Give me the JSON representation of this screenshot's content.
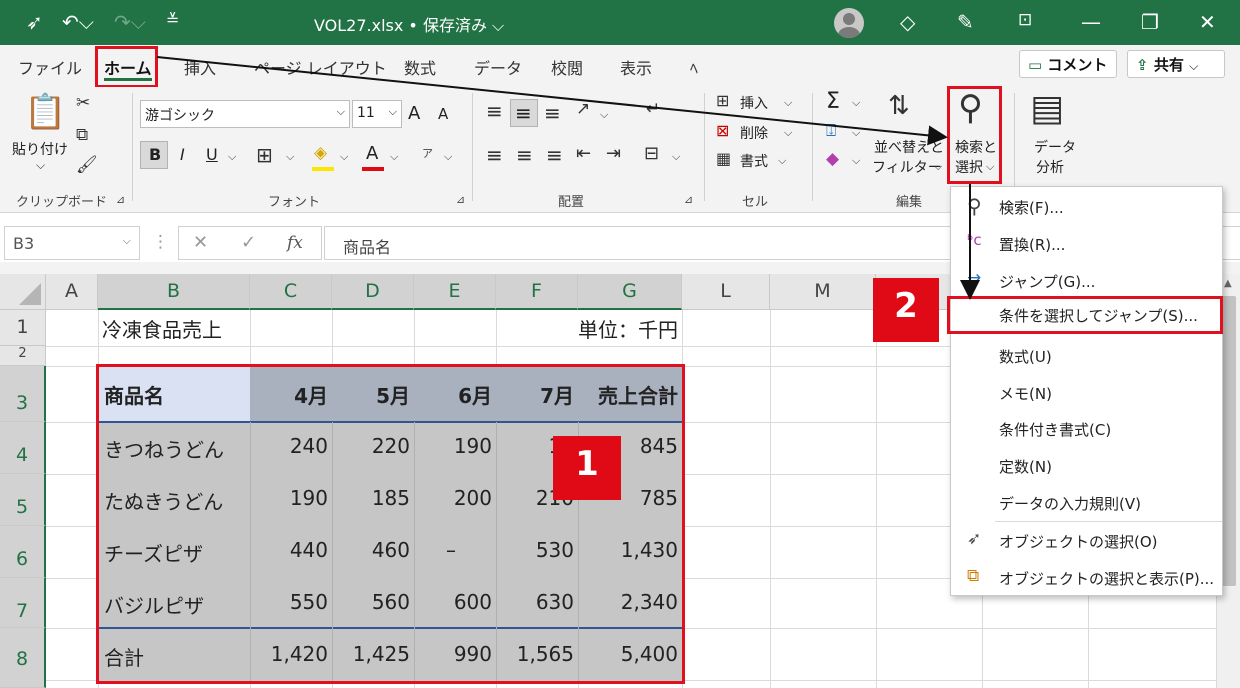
{
  "titlebar": {
    "filename": "VOL27.xlsx • 保存済み ⌵",
    "icons": [
      "select-pointer-icon",
      "undo-icon",
      "redo-icon",
      "customize-icon",
      "diamond-icon",
      "pen-icon",
      "ribbon-display-icon",
      "minimize-icon",
      "restore-icon",
      "close-icon"
    ]
  },
  "tabs": [
    "ファイル",
    "ホーム",
    "挿入",
    "ページ レイアウト",
    "数式",
    "データ",
    "校閲",
    "表示",
    "ﾍ"
  ],
  "comment_label": "コメント",
  "share_label": "共有",
  "ribbon": {
    "clipboard": {
      "paste": "貼り付け",
      "label": "クリップボード"
    },
    "font": {
      "name": "游ゴシック",
      "size": "11",
      "label": "フォント",
      "bold": "B",
      "italic": "I",
      "underline": "U",
      "grow": "A",
      "shrink": "A",
      "font_color": "A",
      "phonetic": "ア"
    },
    "alignment": {
      "label": "配置"
    },
    "cells": {
      "insert": "挿入",
      "delete": "削除",
      "format": "書式",
      "label": "セル"
    },
    "editing": {
      "sum": "Σ",
      "sort_line1": "並べ替えと",
      "sort_line2": "フィルター",
      "find_line1": "検索と",
      "find_line2": "選択",
      "label": "編集"
    },
    "analysis": {
      "line1": "データ",
      "line2": "分析"
    }
  },
  "formula_bar": {
    "namebox": "B3",
    "fx": "fx",
    "value": "商品名"
  },
  "columns": [
    "A",
    "B",
    "C",
    "D",
    "E",
    "F",
    "G",
    "L",
    "M"
  ],
  "rows": [
    "1",
    "2",
    "3",
    "4",
    "5",
    "6",
    "7",
    "8"
  ],
  "sheet": {
    "title": "冷凍食品売上",
    "unit": "単位：千円",
    "header": [
      "商品名",
      "4月",
      "5月",
      "6月",
      "7月",
      "売上合計"
    ],
    "data": [
      [
        "きつねうどん",
        "240",
        "220",
        "190",
        "19",
        "845"
      ],
      [
        "たぬきうどん",
        "190",
        "185",
        "200",
        "210",
        "785"
      ],
      [
        "チーズピザ",
        "440",
        "460",
        "–",
        "530",
        "1,430"
      ],
      [
        "バジルピザ",
        "550",
        "560",
        "600",
        "630",
        "2,340"
      ],
      [
        "合計",
        "1,420",
        "1,425",
        "990",
        "1,565",
        "5,400"
      ]
    ]
  },
  "menu": [
    {
      "label": "検索(F)...",
      "icon": "search-icon"
    },
    {
      "label": "置換(R)...",
      "icon": "replace-icon"
    },
    {
      "label": "ジャンプ(G)...",
      "icon": "arrow-right-icon"
    },
    {
      "label": "条件を選択してジャンプ(S)...",
      "icon": ""
    },
    {
      "label": "数式(U)",
      "icon": ""
    },
    {
      "label": "メモ(N)",
      "icon": ""
    },
    {
      "label": "条件付き書式(C)",
      "icon": ""
    },
    {
      "label": "定数(N)",
      "icon": ""
    },
    {
      "label": "データの入力規則(V)",
      "icon": ""
    },
    {
      "label": "オブジェクトの選択(O)",
      "icon": "pointer-icon"
    },
    {
      "label": "オブジェクトの選択と表示(P)...",
      "icon": "selection-pane-icon"
    }
  ],
  "badges": {
    "one": "1",
    "two": "2"
  },
  "colors": {
    "excel_green": "#217346",
    "highlight_red": "#e0101e",
    "badge_red": "#e00a17"
  }
}
